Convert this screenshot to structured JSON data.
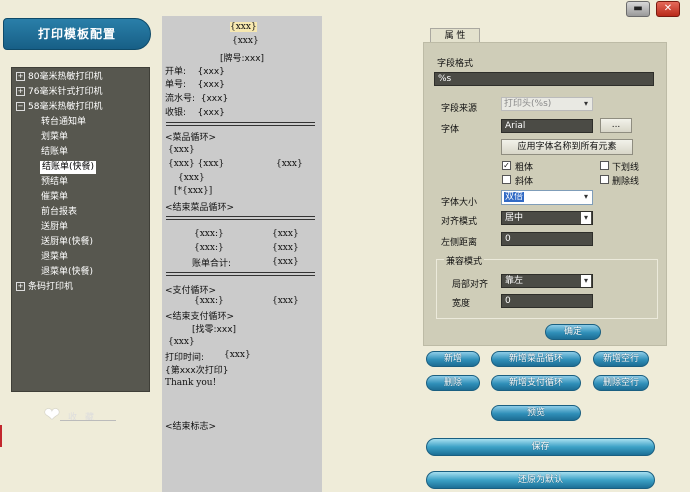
{
  "window": {
    "minimize_label": "▬",
    "close_label": "✕"
  },
  "banner": {
    "title": "打印模板配置"
  },
  "tree": {
    "nodes": [
      {
        "label": "80毫米热敏打印机",
        "toggle": "+"
      },
      {
        "label": "76毫米针式打印机",
        "toggle": "+"
      },
      {
        "label": "58毫米热敏打印机",
        "toggle": "−"
      },
      {
        "label": "条码打印机",
        "toggle": "+"
      }
    ],
    "leaves": [
      "转台通知单",
      "划菜单",
      "结账单",
      "结账单(快餐)",
      "预结单",
      "催菜单",
      "前台报表",
      "送厨单",
      "送厨单(快餐)",
      "退菜单",
      "退菜单(快餐)"
    ],
    "selected": "结账单(快餐)"
  },
  "love": {
    "label": "收藏",
    "icon": "heart-icon"
  },
  "preview": {
    "lines": [
      "{xxx}",
      "{xxx}",
      "[牌号:xxx]",
      "开单:    {xxx}",
      "单号:    {xxx}",
      "流水号:  {xxx}",
      "收银:    {xxx}",
      "<菜品循环>",
      "{xxx}",
      "{xxx} {xxx}",
      "{xxx}",
      "{xxx}",
      "[*{xxx}]",
      "<结束菜品循环>",
      "{xxx:}",
      "{xxx}",
      "{xxx:}",
      "{xxx}",
      "账单合计:",
      "{xxx}",
      "<支付循环>",
      "{xxx:}",
      "{xxx}",
      "<结束支付循环>",
      "[找零:xxx]",
      "{xxx}",
      "打印时间:",
      "{xxx}",
      "{第xxx次打印}",
      "Thank you!",
      "<结束标志>"
    ]
  },
  "props": {
    "tab_label": "属 性",
    "field_format_label": "字段格式",
    "field_format_value": "%s",
    "field_source_label": "字段来源",
    "field_source_value": "打印头(%s)",
    "font_label": "字体",
    "font_value": "Arial",
    "font_browse_label": "...",
    "apply_font_all_label": "应用字体名称到所有元素",
    "bold_label": "粗体",
    "bold_checked": "✓",
    "underline_label": "下划线",
    "italic_label": "斜体",
    "strikeout_label": "删除线",
    "font_size_label": "字体大小",
    "font_size_value": "双倍",
    "align_label": "对齐模式",
    "align_value": "居中",
    "left_margin_label": "左侧距离",
    "left_margin_value": "0",
    "compat_label": "兼容模式",
    "local_align_label": "局部对齐",
    "local_align_value": "靠左",
    "width_label": "宽度",
    "width_value": "0",
    "confirm_label": "确定"
  },
  "actions": {
    "add": "新增",
    "add_dish_loop": "新增菜品循环",
    "add_blank_line": "新增空行",
    "delete": "删除",
    "add_pay_loop": "新增支付循环",
    "delete_blank_line": "删除空行",
    "preview": "预览",
    "save": "保存",
    "restore_default": "还原为默认"
  }
}
